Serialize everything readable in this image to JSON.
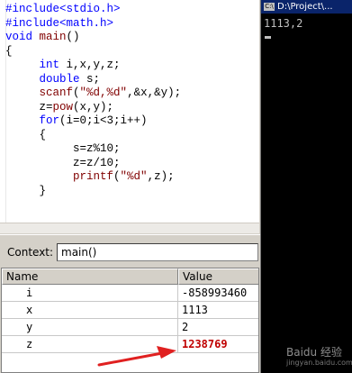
{
  "editor": {
    "lines": [
      [
        "#include<stdio.h>"
      ],
      [
        "#include<math.h>"
      ],
      [
        "void main()"
      ],
      [
        "{"
      ],
      [
        "     int i,x,y,z;"
      ],
      [
        "     double s;"
      ],
      [
        "     scanf(\"%d,%d\",&x,&y);"
      ],
      [
        "     z=pow(x,y);"
      ],
      [
        "     for(i=0;i<3;i++)"
      ],
      [
        "     {"
      ],
      [
        "          s=z%10;"
      ],
      [
        "          z=z/10;"
      ],
      [
        "          printf(\"%d\",z);"
      ],
      [
        "     }"
      ]
    ]
  },
  "console": {
    "title": "D:\\Project\\...",
    "output": "1113,2"
  },
  "watch": {
    "context_label": "Context:",
    "context_value": "main()",
    "col_name": "Name",
    "col_value": "Value",
    "rows": [
      {
        "name": "i",
        "value": "-858993460"
      },
      {
        "name": "x",
        "value": "1113"
      },
      {
        "name": "y",
        "value": "2"
      },
      {
        "name": "z",
        "value": "1238769"
      }
    ]
  },
  "watermark": {
    "text": "Baidu 经验",
    "sub": "jingyan.baidu.com"
  },
  "colors": {
    "changed_value": "#c00000",
    "arrow": "#e02020",
    "console_bg": "#000000"
  }
}
